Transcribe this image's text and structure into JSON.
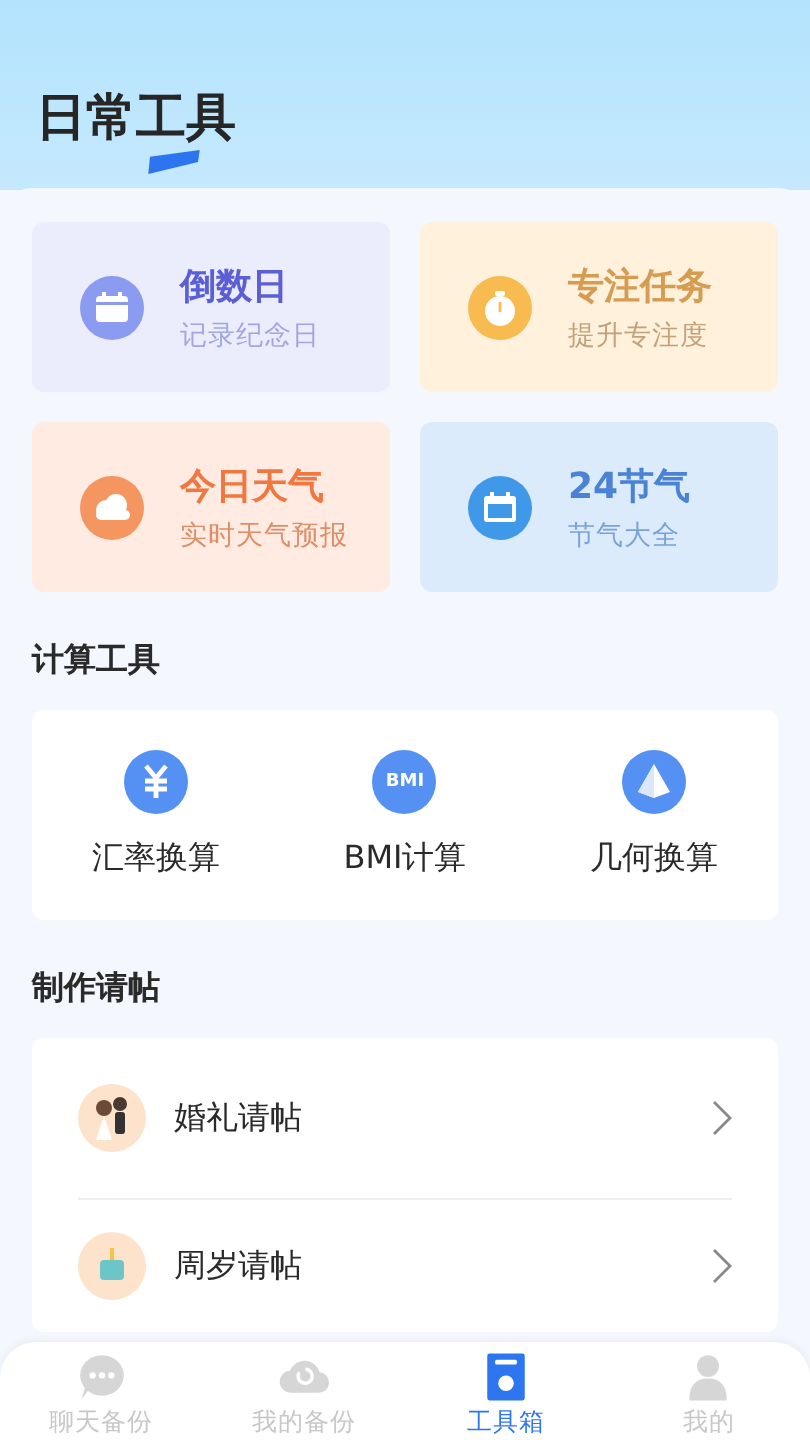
{
  "page_title": "日常工具",
  "quick_tools": [
    {
      "kind": "countdown",
      "title": "倒数日",
      "subtitle": "记录纪念日"
    },
    {
      "kind": "focus",
      "title": "专注任务",
      "subtitle": "提升专注度"
    },
    {
      "kind": "weather",
      "title": "今日天气",
      "subtitle": "实时天气预报"
    },
    {
      "kind": "solar_terms",
      "title": "24节气",
      "subtitle": "节气大全"
    }
  ],
  "calc_section": {
    "title": "计算工具",
    "items": [
      {
        "kind": "currency",
        "label": "汇率换算"
      },
      {
        "kind": "bmi",
        "icon_text": "BMI",
        "label": "BMI计算"
      },
      {
        "kind": "geometry",
        "label": "几何换算"
      }
    ]
  },
  "invite_section": {
    "title": "制作请帖",
    "items": [
      {
        "kind": "wedding",
        "label": "婚礼请帖"
      },
      {
        "kind": "birthday",
        "label": "周岁请帖"
      }
    ]
  },
  "tab_bar": [
    {
      "kind": "chat",
      "label": "聊天备份",
      "selected": false
    },
    {
      "kind": "cloud",
      "label": "我的备份",
      "selected": false
    },
    {
      "kind": "toolbox",
      "label": "工具箱",
      "selected": true
    },
    {
      "kind": "person",
      "label": "我的",
      "selected": false
    }
  ]
}
